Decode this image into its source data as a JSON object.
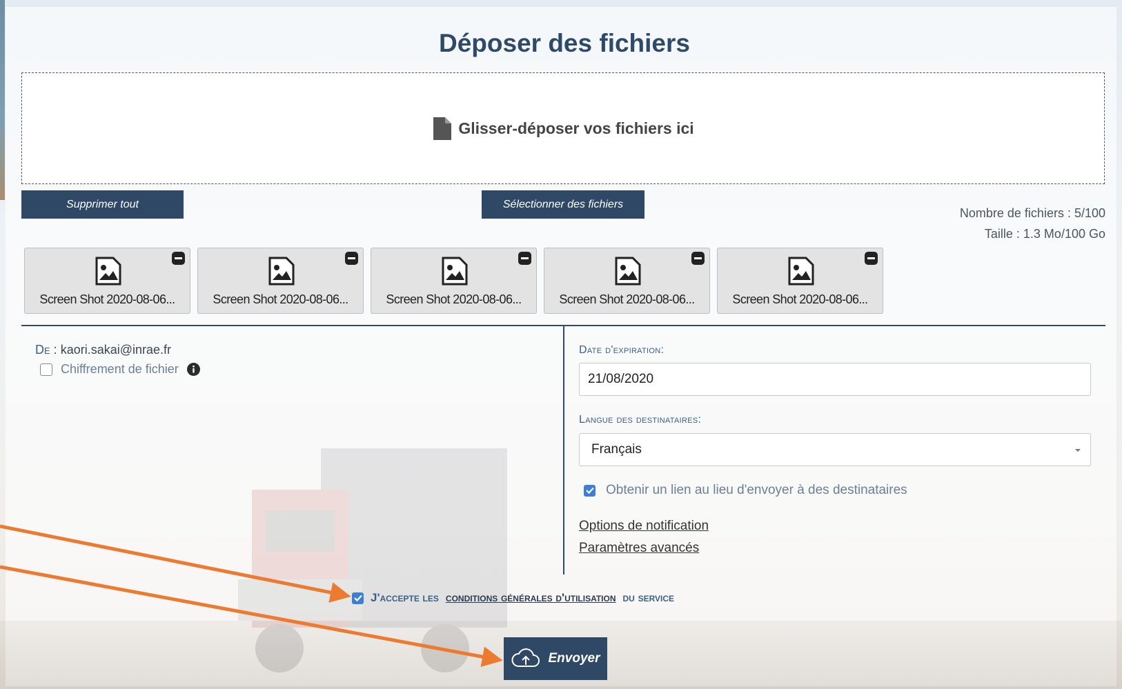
{
  "page": {
    "title": "Déposer des fichiers"
  },
  "dropzone": {
    "text": "Glisser-déposer vos fichiers ici",
    "icon": "file-icon"
  },
  "actions": {
    "delete_all": "Supprimer tout",
    "select_files": "Sélectionner des fichiers"
  },
  "stats": {
    "file_count": "Nombre de fichiers : 5/100",
    "size": "Taille : 1.3 Mo/100 Go"
  },
  "files": [
    {
      "name": "Screen Shot 2020-08-06..."
    },
    {
      "name": "Screen Shot 2020-08-06..."
    },
    {
      "name": "Screen Shot 2020-08-06..."
    },
    {
      "name": "Screen Shot 2020-08-06..."
    },
    {
      "name": "Screen Shot 2020-08-06..."
    }
  ],
  "sender": {
    "label": "De",
    "email": "kaori.sakai@inrae.fr"
  },
  "encryption": {
    "label": "Chiffrement de fichier",
    "checked": false
  },
  "expiration": {
    "label": "Date d'expiration:",
    "value": "21/08/2020"
  },
  "language": {
    "label": "Langue des destinataires:",
    "selected": "Français"
  },
  "get_link": {
    "label": "Obtenir un lien au lieu d'envoyer à des destinataires",
    "checked": true
  },
  "links": {
    "notification_options": "Options de notification",
    "advanced_settings": "Paramètres avancés"
  },
  "terms": {
    "prefix": "J'accepte les",
    "link": "conditions générales d'utilisation",
    "suffix": "du service",
    "checked": true
  },
  "send": {
    "label": "Envoyer"
  },
  "colors": {
    "primary": "#2e4866",
    "title": "#2f4a69",
    "accent_label": "#3a5f85",
    "checkbox": "#3f7fd1",
    "annotation_arrow": "#ec7a30"
  }
}
